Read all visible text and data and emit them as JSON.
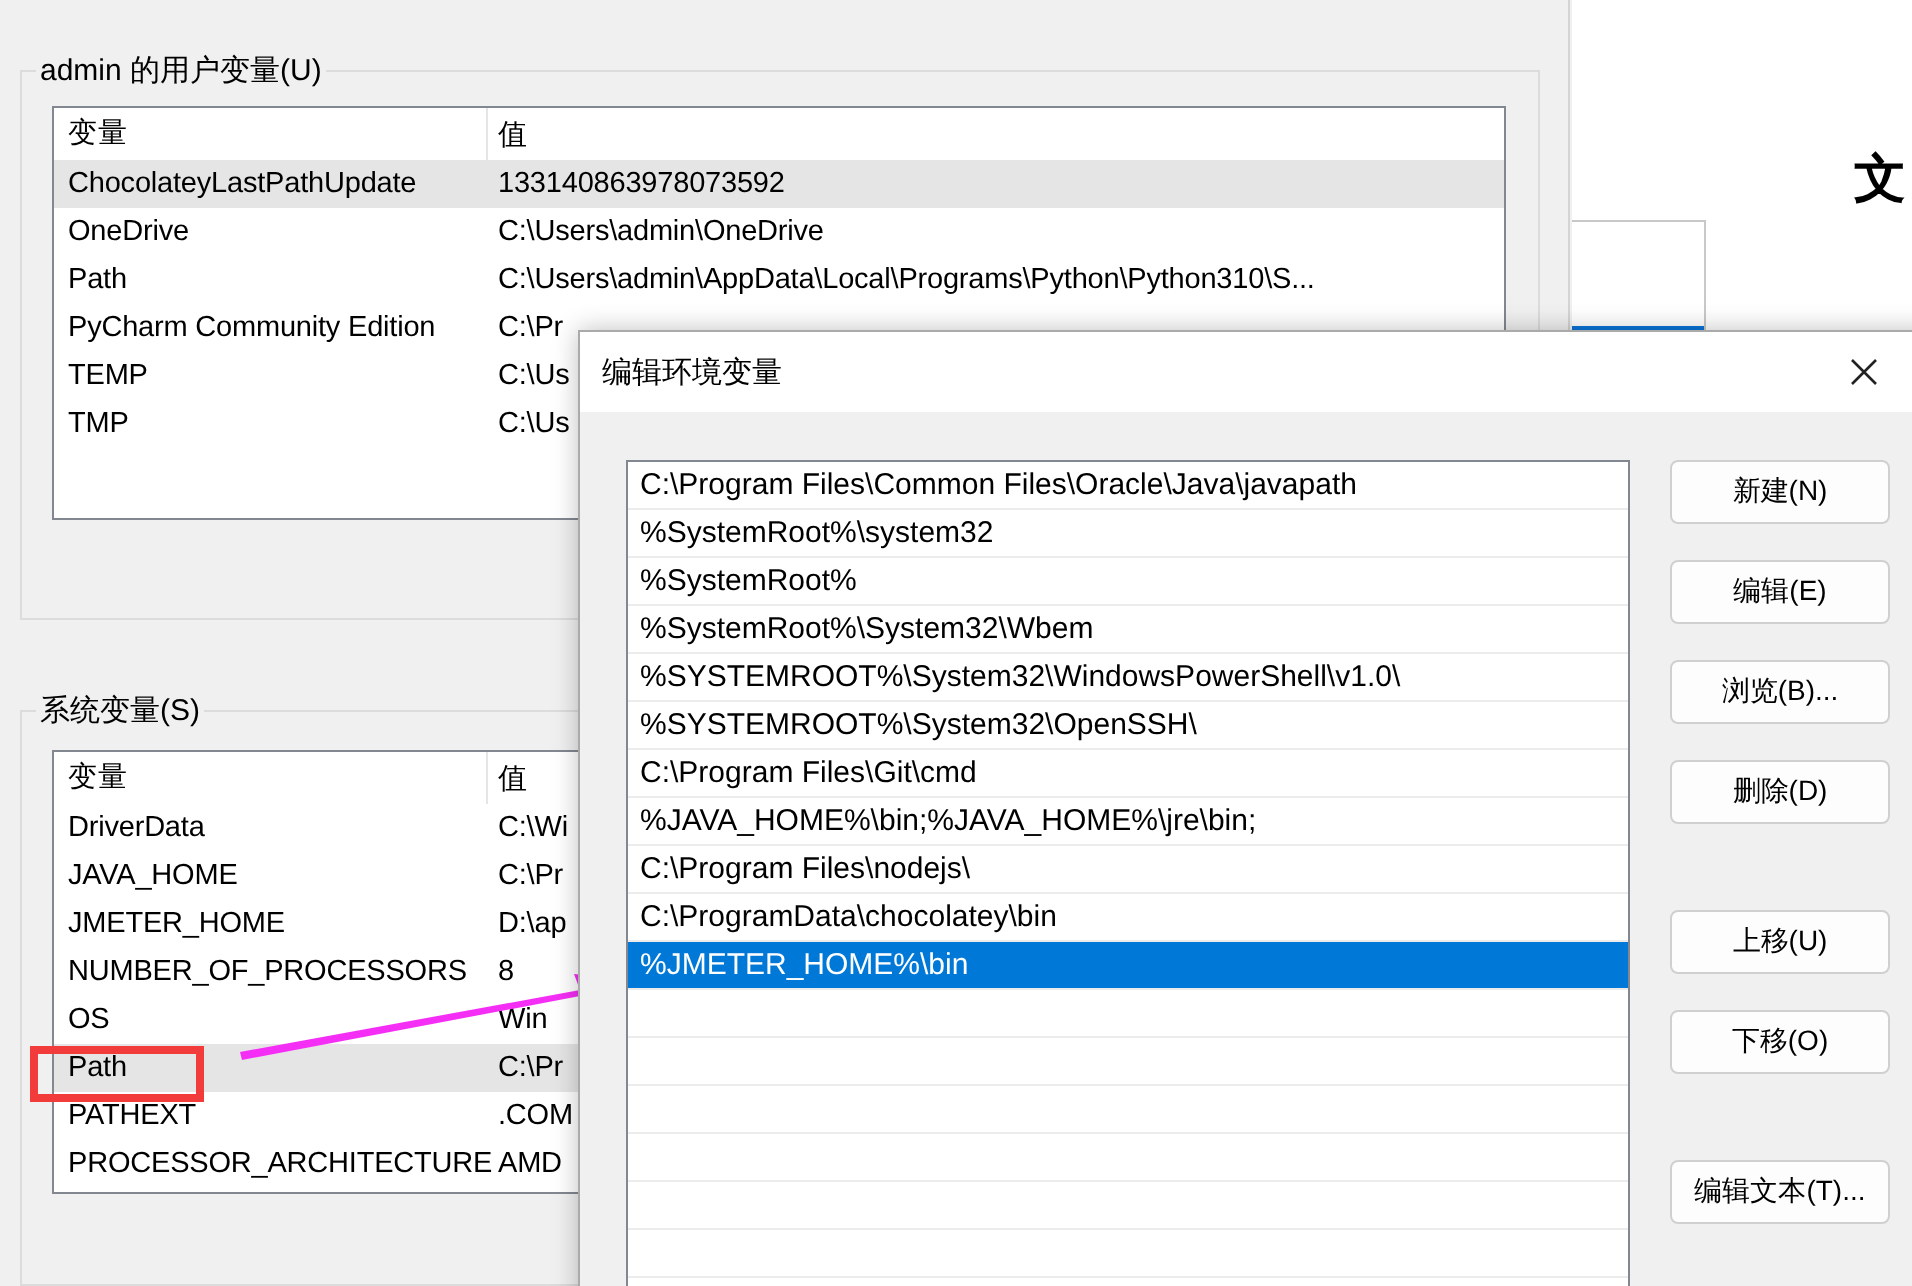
{
  "user_vars": {
    "title": "admin 的用户变量(U)",
    "columns": [
      "变量",
      "值"
    ],
    "rows": [
      {
        "name": "ChocolateyLastPathUpdate",
        "value": "133140863978073592",
        "selected": true
      },
      {
        "name": "OneDrive",
        "value": "C:\\Users\\admin\\OneDrive",
        "selected": false
      },
      {
        "name": "Path",
        "value": "C:\\Users\\admin\\AppData\\Local\\Programs\\Python\\Python310\\S...",
        "selected": false
      },
      {
        "name": "PyCharm Community Edition",
        "value": "C:\\Pr",
        "selected": false
      },
      {
        "name": "TEMP",
        "value": "C:\\Us",
        "selected": false
      },
      {
        "name": "TMP",
        "value": "C:\\Us",
        "selected": false
      }
    ]
  },
  "system_vars": {
    "title": "系统变量(S)",
    "columns": [
      "变量",
      "值"
    ],
    "rows": [
      {
        "name": "DriverData",
        "value": "C:\\Wi",
        "selected": false
      },
      {
        "name": "JAVA_HOME",
        "value": "C:\\Pr",
        "selected": false
      },
      {
        "name": "JMETER_HOME",
        "value": "D:\\ap",
        "selected": false
      },
      {
        "name": "NUMBER_OF_PROCESSORS",
        "value": "8",
        "selected": false
      },
      {
        "name": "OS",
        "value": "Win",
        "selected": false
      },
      {
        "name": "Path",
        "value": "C:\\Pr",
        "selected": true
      },
      {
        "name": "PATHEXT",
        "value": ".COM",
        "selected": false
      },
      {
        "name": "PROCESSOR_ARCHITECTURE",
        "value": "AMD",
        "selected": false
      }
    ]
  },
  "back_window": {
    "heading": "文"
  },
  "dialog": {
    "title": "编辑环境变量",
    "entries": [
      {
        "text": "C:\\Program Files\\Common Files\\Oracle\\Java\\javapath",
        "selected": false
      },
      {
        "text": "%SystemRoot%\\system32",
        "selected": false
      },
      {
        "text": "%SystemRoot%",
        "selected": false
      },
      {
        "text": "%SystemRoot%\\System32\\Wbem",
        "selected": false
      },
      {
        "text": "%SYSTEMROOT%\\System32\\WindowsPowerShell\\v1.0\\",
        "selected": false
      },
      {
        "text": "%SYSTEMROOT%\\System32\\OpenSSH\\",
        "selected": false
      },
      {
        "text": "C:\\Program Files\\Git\\cmd",
        "selected": false
      },
      {
        "text": "%JAVA_HOME%\\bin;%JAVA_HOME%\\jre\\bin;",
        "selected": false
      },
      {
        "text": "C:\\Program Files\\nodejs\\",
        "selected": false
      },
      {
        "text": "C:\\ProgramData\\chocolatey\\bin",
        "selected": false
      },
      {
        "text": "%JMETER_HOME%\\bin",
        "selected": true
      }
    ],
    "button_groups": [
      [
        "新建(N)",
        "编辑(E)",
        "浏览(B)...",
        "删除(D)"
      ],
      [
        "上移(U)",
        "下移(O)"
      ],
      [
        "编辑文本(T)..."
      ]
    ]
  }
}
